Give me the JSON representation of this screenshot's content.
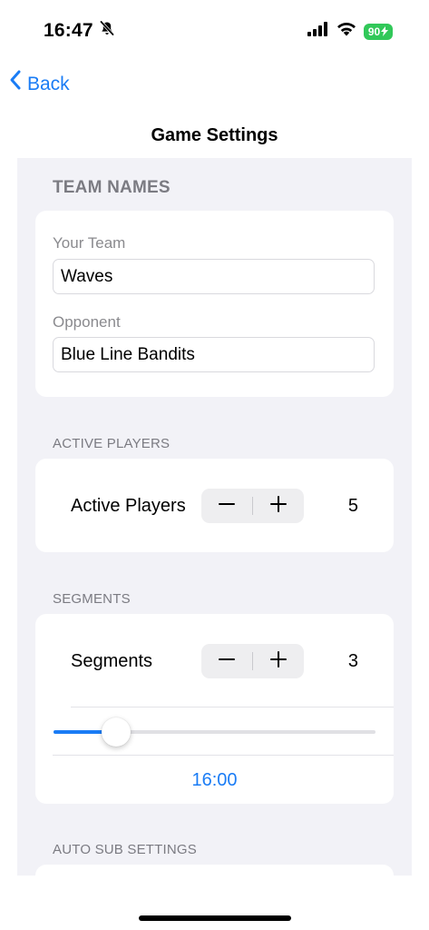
{
  "status_bar": {
    "time": "16:47",
    "battery": "90",
    "icons": [
      "bell-slash-icon",
      "cellular-signal-icon",
      "wifi-icon",
      "battery-charging-icon"
    ]
  },
  "nav": {
    "back_label": "Back",
    "title": "Game Settings"
  },
  "team_names": {
    "header": "TEAM NAMES",
    "your_team_label": "Your Team",
    "your_team_value": "Waves",
    "opponent_label": "Opponent",
    "opponent_value": "Blue Line Bandits"
  },
  "active_players": {
    "header": "ACTIVE PLAYERS",
    "label": "Active Players",
    "value": "5"
  },
  "segments": {
    "header": "SEGMENTS",
    "label": "Segments",
    "value": "3",
    "slider_fraction": 0.165,
    "time_value": "16:00"
  },
  "auto_sub": {
    "header": "AUTO SUB SETTINGS"
  },
  "colors": {
    "accent": "#1a7cf5",
    "battery": "#31c859",
    "grouped_background": "#f2f2f7",
    "secondary_text": "#7b7b82"
  }
}
